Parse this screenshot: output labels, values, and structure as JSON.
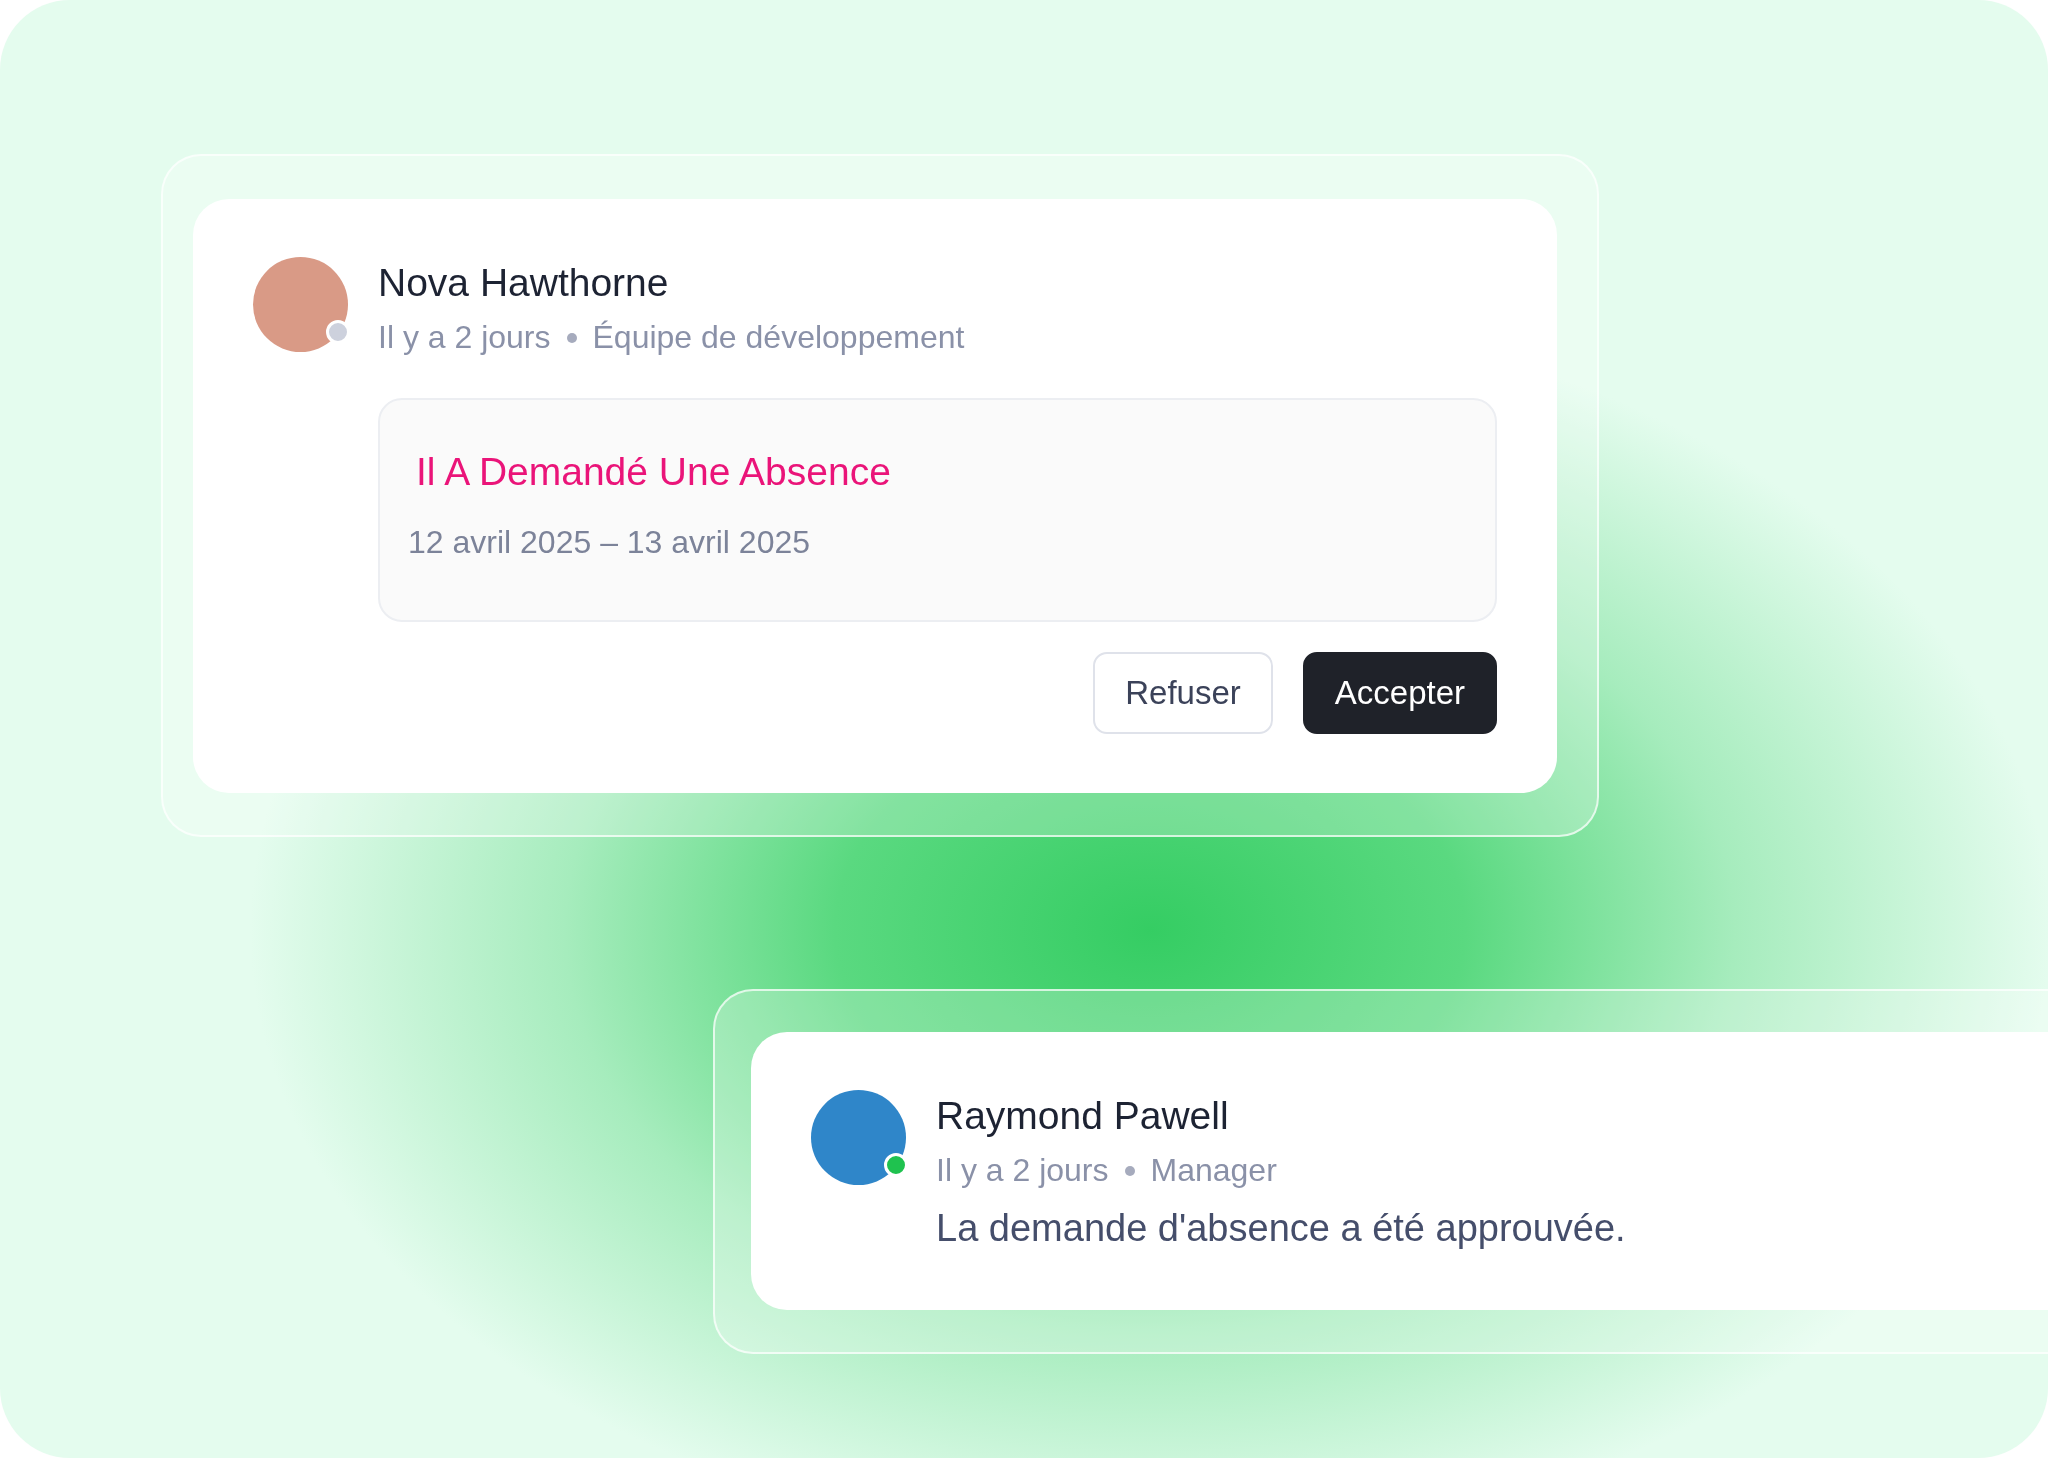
{
  "request_card": {
    "author": {
      "name": "Nova Hawthorne",
      "online": false
    },
    "time": "Il y a 2 jours",
    "team": "Équipe de développement",
    "request": {
      "title": "Il A Demandé Une Absence",
      "dates": "12 avril 2025 – 13 avril 2025"
    },
    "buttons": [
      {
        "label": "Refuser",
        "kind": "secondary"
      },
      {
        "label": "Accepter",
        "kind": "primary"
      }
    ]
  },
  "approval_card": {
    "author": {
      "name": "Raymond Pawell",
      "online": true
    },
    "time": "Il y a 2 jours",
    "team": "Manager",
    "message": "La demande d'absence a été approuvée."
  }
}
